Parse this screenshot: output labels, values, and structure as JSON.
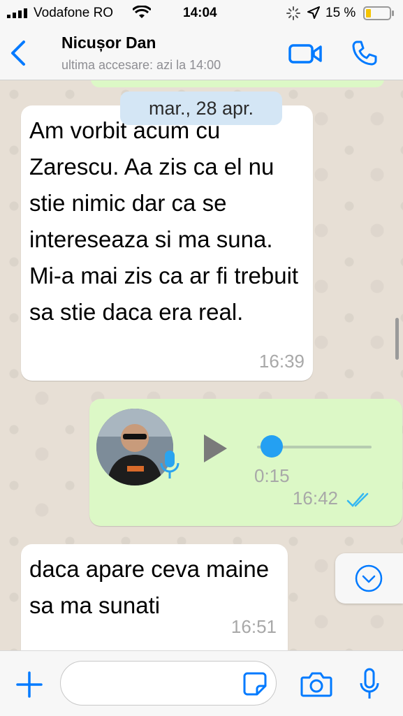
{
  "status_bar": {
    "carrier": "Vodafone RO",
    "time": "14:04",
    "battery_percent": "15 %",
    "icons": [
      "signal-icon",
      "wifi-icon",
      "loading-icon",
      "location-icon",
      "battery-icon"
    ]
  },
  "header": {
    "contact_name": "Nicușor Dan",
    "last_seen": "ultima accesare: azi la 14:00",
    "icons": [
      "back-chevron-icon",
      "video-call-icon",
      "phone-call-icon"
    ]
  },
  "chat": {
    "date_separator": "mar., 28 apr.",
    "messages": [
      {
        "direction": "incoming",
        "type": "text",
        "text": "Am vorbit acum cu Zarescu. Aa zis ca el nu stie nimic dar ca se intereseaza si ma suna. Mi-a mai zis ca ar fi trebuit sa stie daca era real.",
        "time": "16:39"
      },
      {
        "direction": "outgoing",
        "type": "voice",
        "duration": "0:15",
        "playback_progress": 0.03,
        "time": "16:42",
        "read_receipt": "double-check-blue"
      },
      {
        "direction": "incoming",
        "type": "text",
        "text": "daca apare ceva maine sa ma sunati",
        "time": "16:51"
      }
    ]
  },
  "input_bar": {
    "value": "",
    "icons": [
      "plus-icon",
      "sticker-icon",
      "camera-icon",
      "microphone-icon"
    ]
  },
  "colors": {
    "accent": "#007aff",
    "outgoing_bubble": "#dcf8c6",
    "incoming_bubble": "#ffffff",
    "date_chip": "#d4e6f5",
    "read_ticks": "#34b7f1",
    "voice_knob": "#24a0f2"
  }
}
